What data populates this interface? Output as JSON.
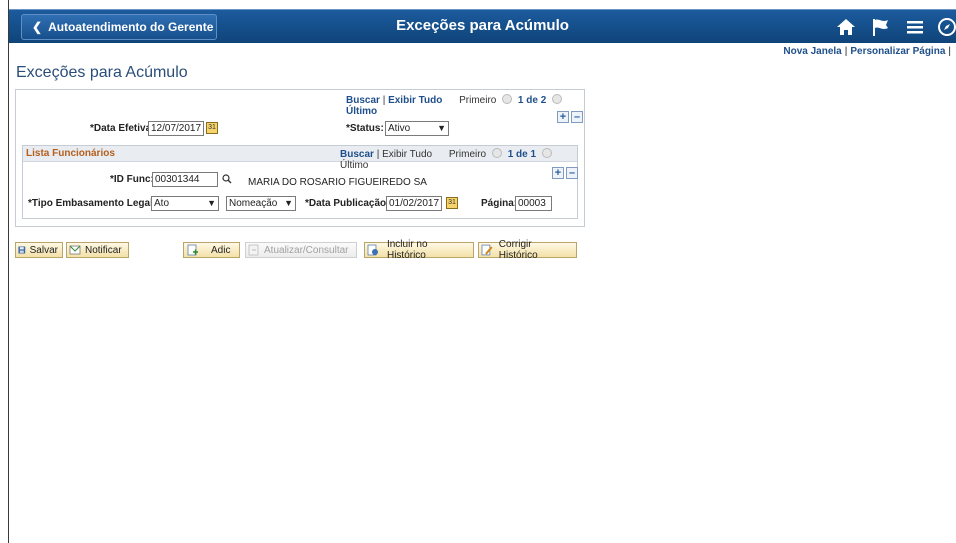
{
  "banner": {
    "home_button_label": "Autoatendimento do Gerente",
    "title": "Exceções para Acúmulo",
    "icons": [
      "home-icon",
      "flag-icon",
      "menu-icon",
      "compass-icon"
    ]
  },
  "top_links": {
    "new_window": "Nova Janela",
    "sep": "|",
    "personalize": "Personalizar Página",
    "sep2": "|"
  },
  "page_title": "Exceções para Acúmulo",
  "header_nav": {
    "search": "Buscar",
    "sep": "|",
    "view_all": "Exibir Tudo",
    "first": "Primeiro",
    "count": "1 de 2",
    "last": "Último"
  },
  "form": {
    "effective_date_label": "*Data Efetiva:",
    "effective_date_value": "12/07/2017",
    "status_label": "*Status:",
    "status_value": "Ativo"
  },
  "employees": {
    "title": "Lista Funcionários",
    "nav": {
      "search": "Buscar",
      "sep": "|",
      "view_all": "Exibir Tudo",
      "first": "Primeiro",
      "count": "1 de 1",
      "last": "Último"
    },
    "id_label": "*ID Func:",
    "id_value": "00301344",
    "employee_name": "MARIA DO ROSARIO FIGUEIREDO SA",
    "legal_basis_label": "*Tipo Embasamento Legal:",
    "legal_basis_value": "Ato",
    "appointment_value": "Nomeação",
    "pub_date_label": "*Data Publicação:",
    "pub_date_value": "01/02/2017",
    "page_label": "Página:",
    "page_value": "00003"
  },
  "buttons": {
    "save": "Salvar",
    "notify": "Notificar",
    "add": "Adic",
    "update": "Atualizar/Consultar",
    "include_history": "Incluir no Histórico",
    "correct_history": "Corrigir Histórico"
  },
  "colors": {
    "banner": "#1c5b9e",
    "link": "#1f4f8a",
    "group_title": "#b45f1c",
    "button": "#f3e1a8"
  }
}
